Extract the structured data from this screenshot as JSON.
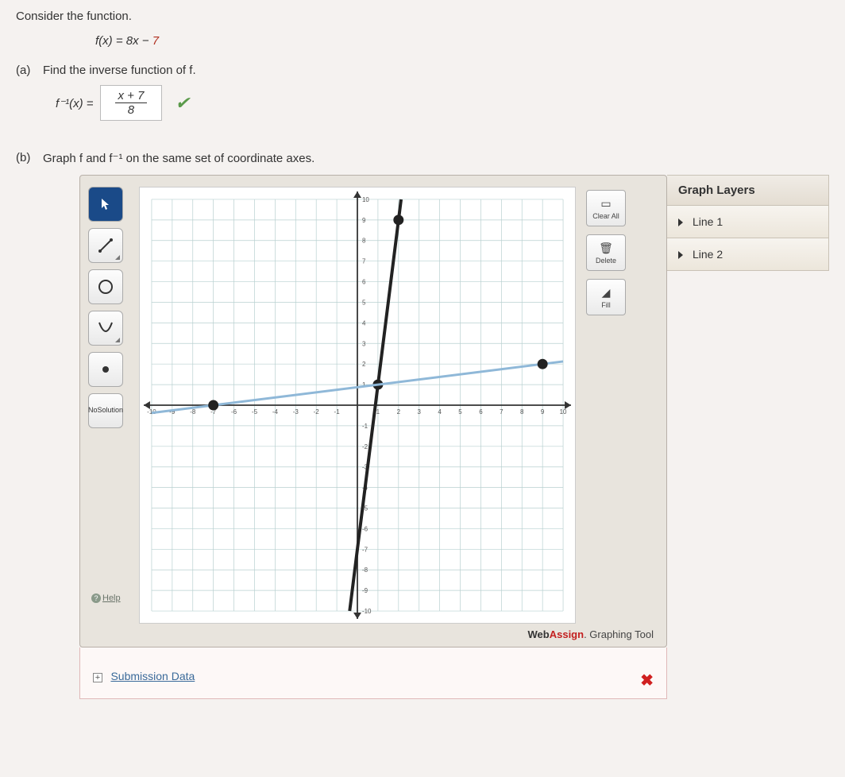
{
  "prompt": "Consider the function.",
  "function_lhs": "f(x) = 8x − ",
  "function_seven": "7",
  "parts": {
    "a": {
      "label": "(a)",
      "text": "Find the inverse function of f."
    },
    "b": {
      "label": "(b)",
      "text": "Graph f and f⁻¹ on the same set of coordinate axes."
    }
  },
  "answer": {
    "lhs": "f⁻¹(x) =",
    "numerator": "x + 7",
    "denominator": "8"
  },
  "palette": {
    "pointer": "pointer",
    "line": "line",
    "circle": "circle",
    "parabola": "parabola",
    "point": "point",
    "no_solution_1": "No",
    "no_solution_2": "Solution",
    "help": "Help"
  },
  "actions": {
    "clear_all": "Clear All",
    "delete": "Delete",
    "fill": "Fill"
  },
  "layers": {
    "header": "Graph Layers",
    "items": [
      "Line 1",
      "Line 2"
    ]
  },
  "footer": {
    "web": "Web",
    "assign": "Assign",
    "suffix": ". Graphing Tool"
  },
  "submission": {
    "link": "Submission Data"
  },
  "chart_data": {
    "type": "line",
    "xlim": [
      -10,
      10
    ],
    "ylim": [
      -10,
      10
    ],
    "x_ticks": [
      -10,
      -9,
      -8,
      -7,
      -6,
      -5,
      -4,
      -3,
      -2,
      -1,
      1,
      2,
      3,
      4,
      5,
      6,
      7,
      8,
      9,
      10
    ],
    "y_ticks": [
      -10,
      -9,
      -8,
      -7,
      -6,
      -5,
      -4,
      -3,
      -2,
      -1,
      1,
      2,
      3,
      4,
      5,
      6,
      7,
      8,
      9,
      10
    ],
    "series": [
      {
        "name": "Line 1 (f)",
        "color": "#222222",
        "equation": "y = 8x - 7",
        "points": [
          [
            -0.375,
            -10
          ],
          [
            2.125,
            10
          ]
        ],
        "marker_points": [
          [
            1,
            1
          ],
          [
            2,
            9
          ]
        ]
      },
      {
        "name": "Line 2 (f⁻¹)",
        "color": "#8fb8d8",
        "equation": "y = (x+7)/8",
        "points": [
          [
            -10,
            -0.375
          ],
          [
            10,
            2.125
          ]
        ],
        "marker_points": [
          [
            -7,
            0
          ],
          [
            9,
            2
          ]
        ]
      }
    ]
  }
}
